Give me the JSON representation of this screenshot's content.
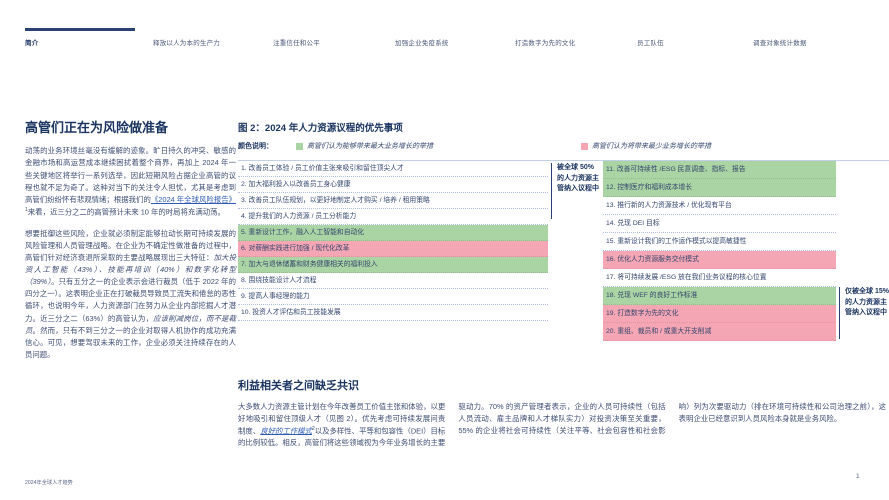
{
  "nav": {
    "tabs": [
      {
        "label": "简介",
        "active": true
      },
      {
        "label": "释放以人为本的生产力",
        "active": false
      },
      {
        "label": "注重信任和公平",
        "active": false
      },
      {
        "label": "加强企业免疫系统",
        "active": false
      },
      {
        "label": "打造数字为先的文化",
        "active": false
      },
      {
        "label": "员工队伍",
        "active": false
      },
      {
        "label": "调查对象统计数据",
        "active": false
      }
    ]
  },
  "intro": {
    "title": "高管们正在为风险做准备",
    "p1_pre": "动荡的业务环境丝毫没有缓解的迹象。旷日持久的冲突、敏感的金融市场和高运营成本继续困扰着整个商界，再加上 2024 年一些关键地区将举行一系列选举，因此短期风险占据企业高管的议程也就不足为奇了。这种对当下的关注令人担忧，尤其是考虑到高管们纷纷怀有悲观情绪；根据我们的",
    "p1_link": "《2024 年全球风险报告》",
    "p1_sup": "1",
    "p1_post": "来看，近三分之二的高管预计未来 10 年的时局将充满动荡。",
    "p2_pre": "想要抵御这些风险，企业就必须制定能够拉动长期可持续发展的风险管理和人员管理战略。在企业为不确定性做准备的过程中，高管们针对经济衰退所采取的主要战略展现出三大特征：",
    "p2_italic1": "加大投资人工智能（43%）、技能再培训（40%）和数字化转型（39%）",
    "p2_mid": "。只有五分之一的企业表示会进行裁员（低于 2022 年的四分之一）。这表明企业正在打破裁员导致员工流失和倦怠的恶性循环，也说明今年，人力资源部门在努力从企业内部挖掘人才潜力。近三分之二（63%）的高管认为，",
    "p2_italic2": "应该削减岗位，而不是裁员",
    "p2_post": "。然而，只有不到三分之一的企业对取得人机协作的成功充满信心。可见，想要驾驭未来的工作，企业必须关注持续存在的人员问题。"
  },
  "figure": {
    "title": "图 2：2024 年人力资源议程的优先事项",
    "legend_label": "颜色说明：",
    "legend_green": "高管们认为能够带来最大业务增长的举措",
    "legend_pink": "高管们认为将带来最少业务增长的举措",
    "annotation_left": "被全球 50% 的人力资源主管纳入议程中",
    "annotation_right": "仅被全球 15% 的人力资源主管纳入议程中",
    "colors": {
      "green_highlight": "#abd4a4",
      "pink_highlight": "#f4a6b4",
      "heading_navy": "#1c3561"
    },
    "items_left": [
      {
        "text": "1. 改善员工体验 / 员工价值主张来吸引和留住顶尖人才",
        "highlight": "none"
      },
      {
        "text": "2. 加大福利投入以改善员工身心健康",
        "highlight": "none"
      },
      {
        "text": "3. 改善员工队伍规划，以更好地制定人才购买 / 培养 / 租用策略",
        "highlight": "none"
      },
      {
        "text": "4. 提升我们的人力资源 / 员工分析能力",
        "highlight": "none"
      },
      {
        "text": "5. 重新设计工作，融入人工智能和自动化",
        "highlight": "green"
      },
      {
        "text": "6. 对薪酬实践进行加强 / 现代化改革",
        "highlight": "pink"
      },
      {
        "text": "7. 加大与退休储蓄和财务健康相关的福利投入",
        "highlight": "green"
      },
      {
        "text": "8. 围绕技能设计人才流程",
        "highlight": "none"
      },
      {
        "text": "9. 提高人事经理的能力",
        "highlight": "none"
      },
      {
        "text": "10. 投资人才评估和员工技能发展",
        "highlight": "none"
      }
    ],
    "items_right": [
      {
        "text": "11. 改善可持续性 /ESG 民意调查、指标、报告",
        "highlight": "green"
      },
      {
        "text": "12. 控制医疗和福利成本增长",
        "highlight": "green"
      },
      {
        "text": "13. 推行新的人力资源技术 / 优化现有平台",
        "highlight": "none"
      },
      {
        "text": "14. 兑现 DEI 目标",
        "highlight": "none"
      },
      {
        "text": "15. 重新设计我们的工作运作模式以提高敏捷性",
        "highlight": "none"
      },
      {
        "text": "16. 优化人力资源服务交付模式",
        "highlight": "pink"
      },
      {
        "text": "17. 将可持续发展 /ESG 放在我们业务议程的核心位置",
        "highlight": "none"
      },
      {
        "text": "18. 兑现 WEF 的良好工作标准",
        "highlight": "green"
      },
      {
        "text": "19. 打造数字为先的文化",
        "highlight": "pink"
      },
      {
        "text": "20. 重组、裁员和 / 或重大开支削减",
        "highlight": "pink"
      }
    ]
  },
  "consensus": {
    "title": "利益相关者之间缺乏共识",
    "p_pre": "大多数人力资源主管计划在今年改善员工价值主张和体验，以更好地吸引和留住顶级人才（见图 2）。优先考虑可持续发展问责制度、",
    "p_link": "良好的工作模式",
    "p_sup": "2",
    "p_post": "以及多样性、平等和包容性（DEI）目标的比例较低。相反，高管们将这些领域视为今年业务增长的主要驱动力。70% 的资产管理者表示，企业的人员可持续性（包括人员流动、雇主品牌和人才梯队实力）对投资决策至关重要，55% 的企业将社会可持续性（关注平等、社会包容性和社会影响）列为次要驱动力（排在环境可持续性和公司治理之前），这表明企业已经意识到人员风险本身就是业务风险。"
  },
  "footer": {
    "left": "2024年全球人才趋势",
    "page_number": "1"
  }
}
